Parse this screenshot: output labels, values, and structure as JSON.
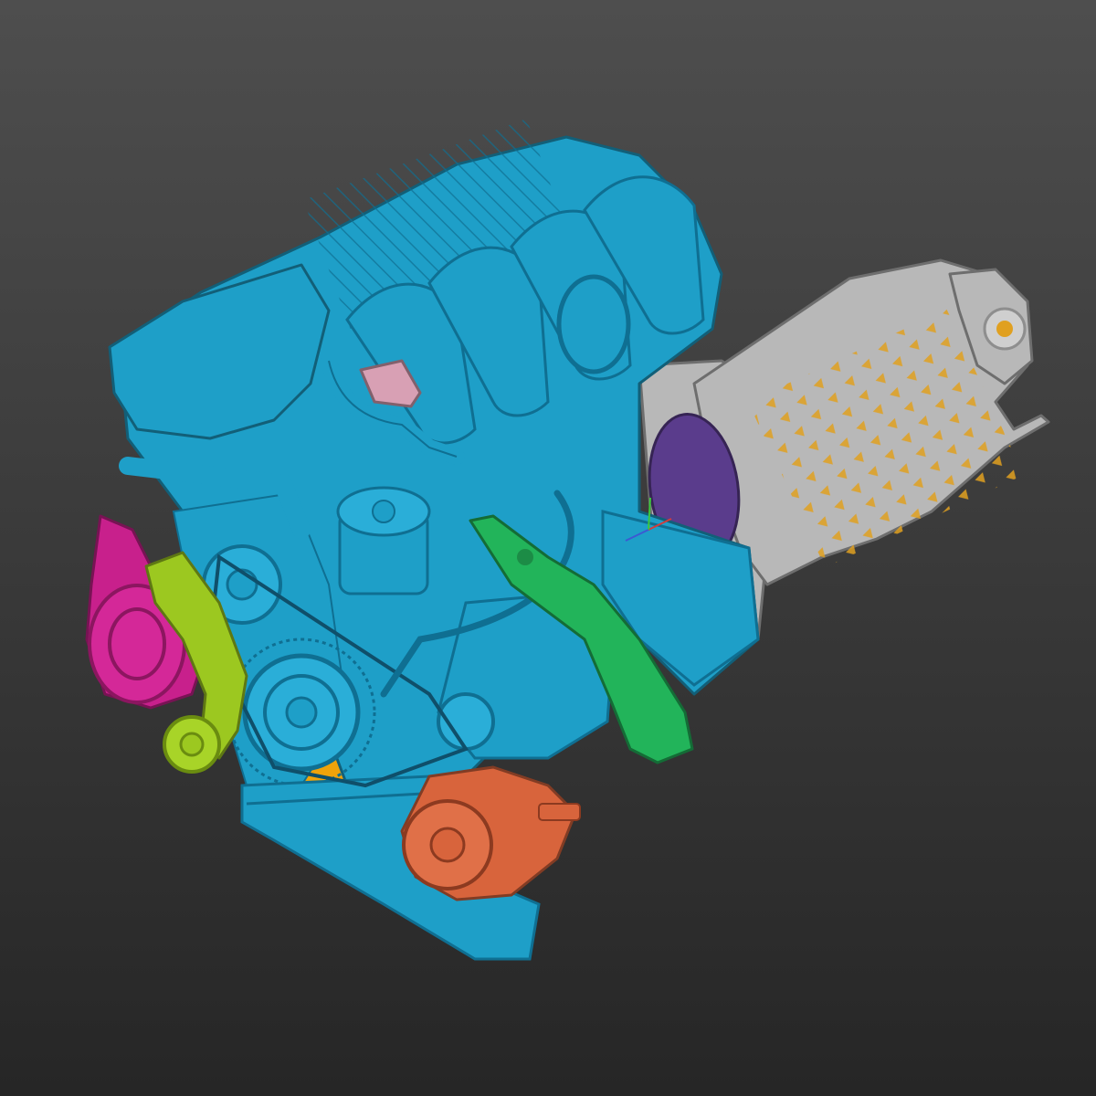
{
  "viewer": {
    "background_top": "#4e4e4e",
    "background_bottom": "#262626"
  },
  "model": {
    "name": "engine-and-gearbox-scan",
    "parts": [
      {
        "name": "engine-block",
        "color": "#1e9fc8"
      },
      {
        "name": "block-exposed-surface",
        "color": "#f0a30a"
      },
      {
        "name": "transmission",
        "color": "#b8b8b8"
      },
      {
        "name": "ac-compressor",
        "color": "#c8208c"
      },
      {
        "name": "tensioner-bracket",
        "color": "#9cc820"
      },
      {
        "name": "engine-mount-bracket",
        "color": "#22b45a"
      },
      {
        "name": "water-pump",
        "color": "#d8643c"
      },
      {
        "name": "flywheel",
        "color": "#5a3c8c"
      },
      {
        "name": "manifold-port",
        "color": "#d8a0b4"
      }
    ],
    "axis_colors": {
      "x": "#d23c3c",
      "y": "#3cc83c",
      "z": "#3c5ad2"
    }
  }
}
